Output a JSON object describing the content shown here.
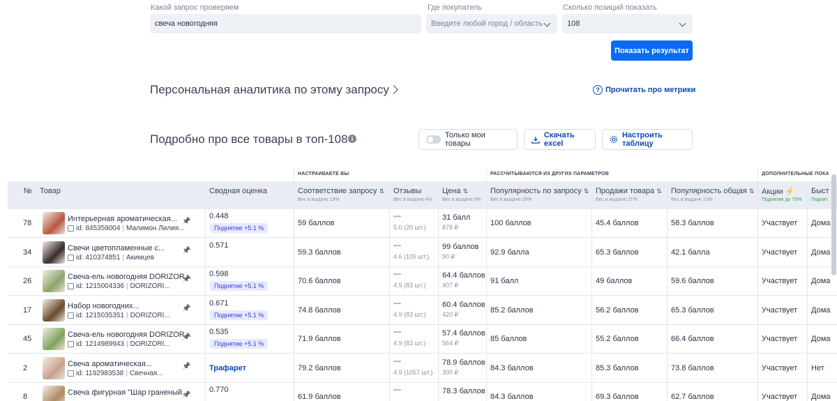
{
  "search": {
    "query_label": "Какой запрос проверяем",
    "query_value": "свеча новогодняя",
    "city_label": "Где покупатель",
    "city_placeholder": "Введите любой город / область",
    "count_label": "Сколько позиций показать",
    "count_value": "108",
    "submit_label": "Показать результат"
  },
  "analytics": {
    "title": "Персональная аналитика по этому запросу",
    "metrics_link": "Прочитать про метрики"
  },
  "details": {
    "title": "Подробно про все товары в топ-108",
    "only_mine": "Только мои товары",
    "download": "Скачать excel",
    "configure": "Настроить таблицу"
  },
  "table": {
    "groups": [
      "НАСТРАИВАЕТЕ ВЫ",
      "РАССЧИТЫВАЮТСЯ ИЗ ДРУГИХ ПАРАМЕТРОВ",
      "ДОПОЛНИТЕЛЬНЫЕ ПОКА"
    ],
    "columns": {
      "num": "№",
      "product": "Товар",
      "score": "Сводная оценка",
      "relevance": "Соответствие запросу",
      "relevance_sub": "Вес в выдаче 19%",
      "reviews": "Отзывы",
      "reviews_sub": "Вес в выдаче 4%",
      "price": "Цена",
      "price_sub": "Вес в выдаче 5%",
      "popularity_query": "Популярность по запросу",
      "popularity_query_sub": "Вес в выдаче 28%",
      "sales": "Продажи товара",
      "sales_sub": "Вес в выдаче 21%",
      "popularity_total": "Популярность общая",
      "popularity_total_sub": "Вес в выдаче 10%",
      "promo": "Акции",
      "promo_sub": "Поднятие до 70%",
      "fast": "Быст",
      "fast_sub": "Поднят"
    },
    "rows": [
      {
        "num": "78",
        "name": "Интерьерная ароматическая...",
        "id": "id: 845359004",
        "seller": "Малимон Лилия...",
        "score": "0.448",
        "badge": "Поднятие +5.1 %",
        "relevance": "59 баллов",
        "reviews": "---",
        "reviews_sub": "5.0 (20 шт.)",
        "price": "31 балл",
        "price_sub": "878 ₽",
        "pop_q": "100 баллов",
        "sales": "45.4 баллов",
        "pop_t": "58.3 баллов",
        "promo": "Участвует",
        "fast": "Дома"
      },
      {
        "num": "34",
        "name": "Свечи цветопламенные с...",
        "id": "id: 410374851",
        "seller": "Акимцев",
        "score": "0.571",
        "badge": "",
        "relevance": "59.3 баллов",
        "reviews": "---",
        "reviews_sub": "4.6 (105 шт.)",
        "price": "99 баллов",
        "price_sub": "90 ₽",
        "pop_q": "92.9 балла",
        "sales": "65.3 баллов",
        "pop_t": "42.1 балла",
        "promo": "Участвует",
        "fast": "Дома"
      },
      {
        "num": "26",
        "name": "Свеча-ель новогодняя DORIZOR...",
        "id": "id: 1215004336",
        "seller": "DORIZORI...",
        "score": "0.598",
        "badge": "Поднятие +5.1 %",
        "relevance": "70.6 баллов",
        "reviews": "---",
        "reviews_sub": "4.9 (83 шт.)",
        "price": "64.4 баллов",
        "price_sub": "407 ₽",
        "pop_q": "91 балл",
        "sales": "49 баллов",
        "pop_t": "59.6 баллов",
        "promo": "Участвует",
        "fast": "Дома"
      },
      {
        "num": "17",
        "name": "Набор новогодних...",
        "id": "id: 1215035351",
        "seller": "DORIZORI...",
        "score": "0.671",
        "badge": "Поднятие +5.1 %",
        "relevance": "74.8 баллов",
        "reviews": "---",
        "reviews_sub": "4.9 (83 шт.)",
        "price": "60.4 баллов",
        "price_sub": "420 ₽",
        "pop_q": "85.2 баллов",
        "sales": "56.2 баллов",
        "pop_t": "65.3 баллов",
        "promo": "Участвует",
        "fast": "Дома"
      },
      {
        "num": "45",
        "name": "Свеча-ель новогодняя DORIZOR...",
        "id": "id: 1214989943",
        "seller": "DORIZORI...",
        "score": "0.535",
        "badge": "Поднятие +5.1 %",
        "relevance": "71.9 баллов",
        "reviews": "---",
        "reviews_sub": "4.9 (83 шт.)",
        "price": "57.4 баллов",
        "price_sub": "564 ₽",
        "pop_q": "85 баллов",
        "sales": "55.2 баллов",
        "pop_t": "66.4 баллов",
        "promo": "Участвует",
        "fast": "Дома"
      },
      {
        "num": "2",
        "name": "Свеча ароматическая...",
        "id": "id: 1192983538",
        "seller": "Свечная...",
        "score": "Трафарет",
        "badge": "",
        "relevance": "79.2 баллов",
        "reviews": "---",
        "reviews_sub": "4.9 (1057 шт.)",
        "price": "78.9 баллов",
        "price_sub": "300 ₽",
        "pop_q": "84.3 баллов",
        "sales": "85.3 баллов",
        "pop_t": "73.8 баллов",
        "promo": "Участвует",
        "fast": "Нет"
      },
      {
        "num": "8",
        "name": "Свеча фигурная \"Шар граненый...",
        "id": "",
        "seller": "",
        "score": "0.770",
        "badge": "",
        "relevance": "61.9 баллов",
        "reviews": "---",
        "reviews_sub": "",
        "price": "78.3 баллов",
        "price_sub": "",
        "pop_q": "84.3 баллов",
        "sales": "69.3 баллов",
        "pop_t": "62.7 баллов",
        "promo": "Участвует",
        "fast": "Дома"
      }
    ],
    "thumb_colors": [
      "#b9563f",
      "#3a2a2a",
      "#8ea36b",
      "#6b4a2a",
      "#7ea35e",
      "#c9a08a",
      "#b08a5e"
    ]
  }
}
